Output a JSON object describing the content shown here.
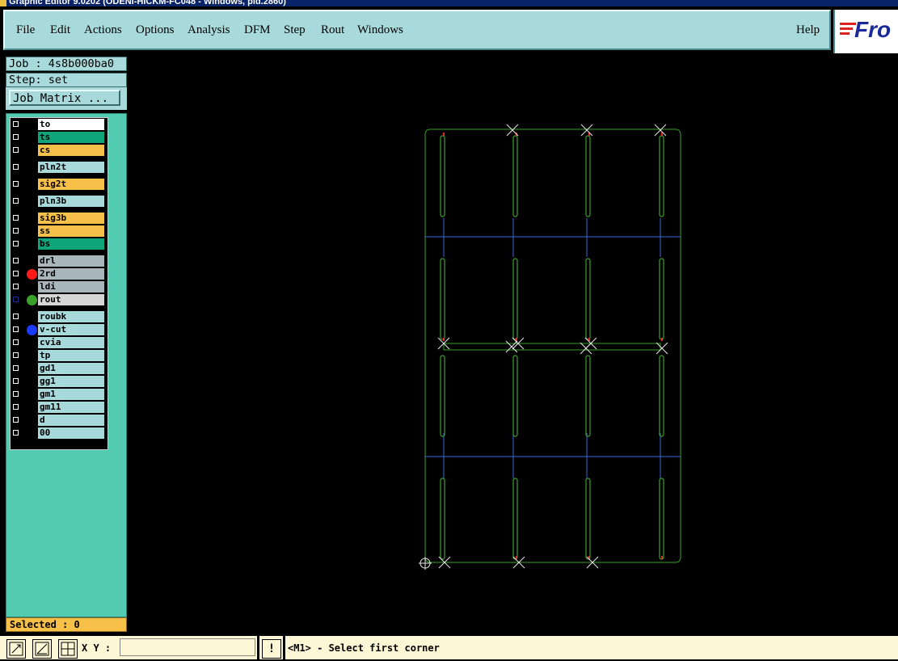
{
  "window": {
    "title": "Graphic Editor 9.0202 (ODENI-HICKM-FC048 - Windows, pid.2860)"
  },
  "menu": {
    "items": [
      "File",
      "Edit",
      "Actions",
      "Options",
      "Analysis",
      "DFM",
      "Step",
      "Rout",
      "Windows"
    ],
    "help": "Help",
    "logo": "Fro"
  },
  "job": {
    "label": "Job : 4s8b000ba0",
    "step": "Step: set",
    "matrix_button": "Job Matrix ..."
  },
  "layers": [
    {
      "name": "to",
      "color": "#ffffff",
      "dot": null
    },
    {
      "name": "ts",
      "color": "#0ea57a",
      "dot": null
    },
    {
      "name": "cs",
      "color": "#f7c049",
      "dot": null
    },
    {
      "name": "pln2t",
      "color": "#a8dadc",
      "dot": null
    },
    {
      "name": "sig2t",
      "color": "#f7c049",
      "dot": null
    },
    {
      "name": "pln3b",
      "color": "#a8dadc",
      "dot": null
    },
    {
      "name": "sig3b",
      "color": "#f7c049",
      "dot": null
    },
    {
      "name": "ss",
      "color": "#f7c049",
      "dot": null
    },
    {
      "name": "bs",
      "color": "#0ea57a",
      "dot": null
    },
    {
      "name": "drl",
      "color": "#a9b6bc",
      "dot": null
    },
    {
      "name": "2rd",
      "color": "#a9b6bc",
      "dot": "#ff1a1a"
    },
    {
      "name": "ldi",
      "color": "#a9b6bc",
      "dot": null
    },
    {
      "name": "rout",
      "color": "#d6d6d6",
      "dot": "#3aa12a",
      "selected": true
    },
    {
      "name": "roubk",
      "color": "#a8dadc",
      "dot": null
    },
    {
      "name": "v-cut",
      "color": "#a8dadc",
      "dot": "#1a3aff"
    },
    {
      "name": "cvia",
      "color": "#a8dadc",
      "dot": null
    },
    {
      "name": "tp",
      "color": "#a8dadc",
      "dot": null
    },
    {
      "name": "gd1",
      "color": "#a8dadc",
      "dot": null
    },
    {
      "name": "gg1",
      "color": "#a8dadc",
      "dot": null
    },
    {
      "name": "gm1",
      "color": "#a8dadc",
      "dot": null
    },
    {
      "name": "gm11",
      "color": "#a8dadc",
      "dot": null
    },
    {
      "name": "d",
      "color": "#a8dadc",
      "dot": null
    },
    {
      "name": "00",
      "color": "#a8dadc",
      "dot": null
    }
  ],
  "selected": "Selected : 0",
  "status": {
    "xy_label": "X Y :",
    "xy_value": "",
    "message": "<M1> - Select first corner",
    "bang": "!"
  }
}
